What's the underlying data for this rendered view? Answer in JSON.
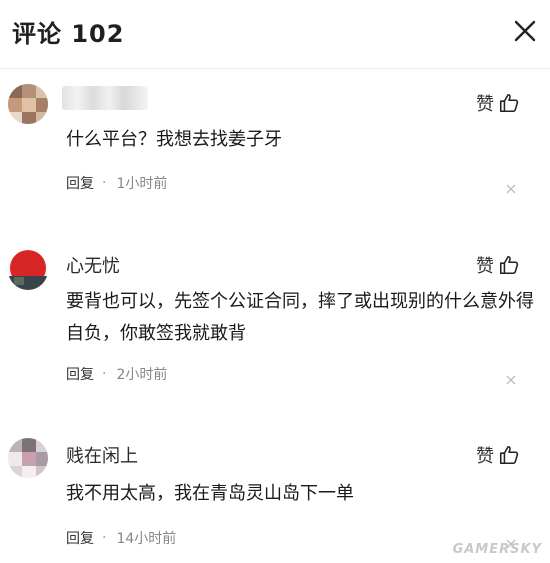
{
  "header": {
    "title": "评论 102"
  },
  "comments": [
    {
      "username": "",
      "text": "什么平台？我想去找姜子牙",
      "like_label": "赞",
      "reply_label": "回复",
      "separator": "·",
      "time": "1小时前"
    },
    {
      "username": "心无忧",
      "text": "要背也可以，先签个公证合同，摔了或出现别的什么意外得自负，你敢签我就敢背",
      "like_label": "赞",
      "reply_label": "回复",
      "separator": "·",
      "time": "2小时前"
    },
    {
      "username": "贱在闲上",
      "text": "我不用太高，我在青岛灵山岛下一单",
      "like_label": "赞",
      "reply_label": "回复",
      "separator": "·",
      "time": "14小时前"
    }
  ],
  "watermark": "GAMERSKY",
  "icons": {
    "close": "close-icon",
    "like": "thumbs-up-icon",
    "delete": "close-small-icon"
  }
}
